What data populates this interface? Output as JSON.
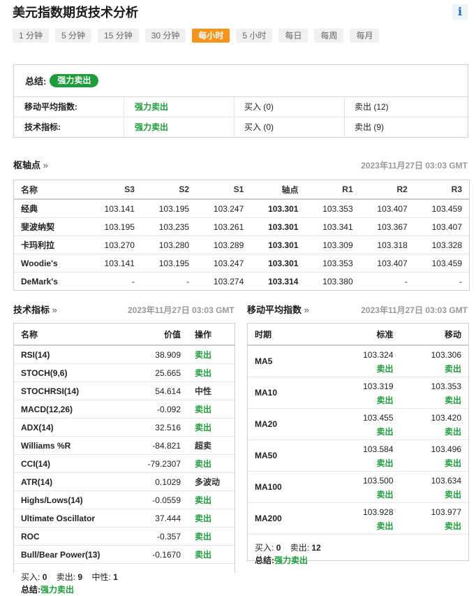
{
  "page_title": "美元指数期货技术分析",
  "info_icon": "i",
  "tabs": [
    "1 分钟",
    "5 分钟",
    "15 分钟",
    "30 分钟",
    "每小时",
    "5 小时",
    "每日",
    "每周",
    "每月"
  ],
  "active_tab": "每小时",
  "summary": {
    "label": "总结:",
    "verdict": "强力卖出",
    "rows": [
      {
        "name": "移动平均指数:",
        "verdict": "强力卖出",
        "buy": "买入 (0)",
        "sell": "卖出 (12)"
      },
      {
        "name": "技术指标:",
        "verdict": "强力卖出",
        "buy": "买入 (0)",
        "sell": "卖出 (9)"
      }
    ]
  },
  "pivot": {
    "title": "枢轴点",
    "arrow": "»",
    "time": "2023年11月27日 03:03 GMT",
    "headers": [
      "名称",
      "S3",
      "S2",
      "S1",
      "轴点",
      "R1",
      "R2",
      "R3"
    ],
    "rows": [
      [
        "经典",
        "103.141",
        "103.195",
        "103.247",
        "103.301",
        "103.353",
        "103.407",
        "103.459"
      ],
      [
        "斐波纳契",
        "103.195",
        "103.235",
        "103.261",
        "103.301",
        "103.341",
        "103.367",
        "103.407"
      ],
      [
        "卡玛利拉",
        "103.270",
        "103.280",
        "103.289",
        "103.301",
        "103.309",
        "103.318",
        "103.328"
      ],
      [
        "Woodie's",
        "103.141",
        "103.195",
        "103.247",
        "103.301",
        "103.353",
        "103.407",
        "103.459"
      ],
      [
        "DeMark's",
        "-",
        "-",
        "103.274",
        "103.314",
        "103.380",
        "-",
        "-"
      ]
    ]
  },
  "indicators": {
    "title": "技术指标",
    "arrow": "»",
    "time": "2023年11月27日 03:03 GMT",
    "headers": [
      "名称",
      "价值",
      "操作"
    ],
    "rows": [
      {
        "name": "RSI(14)",
        "value": "38.909",
        "action": "卖出",
        "tone": "green"
      },
      {
        "name": "STOCH(9,6)",
        "value": "25.665",
        "action": "卖出",
        "tone": "green"
      },
      {
        "name": "STOCHRSI(14)",
        "value": "54.614",
        "action": "中性",
        "tone": "dark"
      },
      {
        "name": "MACD(12,26)",
        "value": "-0.092",
        "action": "卖出",
        "tone": "green"
      },
      {
        "name": "ADX(14)",
        "value": "32.516",
        "action": "卖出",
        "tone": "green"
      },
      {
        "name": "Williams %R",
        "value": "-84.821",
        "action": "超卖",
        "tone": "dark"
      },
      {
        "name": "CCI(14)",
        "value": "-79.2307",
        "action": "卖出",
        "tone": "green"
      },
      {
        "name": "ATR(14)",
        "value": "0.1029",
        "action": "多波动",
        "tone": "dark"
      },
      {
        "name": "Highs/Lows(14)",
        "value": "-0.0559",
        "action": "卖出",
        "tone": "green"
      },
      {
        "name": "Ultimate Oscillator",
        "value": "37.444",
        "action": "卖出",
        "tone": "green"
      },
      {
        "name": "ROC",
        "value": "-0.357",
        "action": "卖出",
        "tone": "green"
      },
      {
        "name": "Bull/Bear Power(13)",
        "value": "-0.1670",
        "action": "卖出",
        "tone": "green"
      }
    ],
    "footer": {
      "buy_label": "买入:",
      "buy": "0",
      "sell_label": "卖出:",
      "sell": "9",
      "neutral_label": "中性:",
      "neutral": "1",
      "summary_label": "总结:",
      "summary": "强力卖出"
    }
  },
  "moving_averages": {
    "title": "移动平均指数",
    "arrow": "»",
    "time": "2023年11月27日 03:03 GMT",
    "headers": [
      "时期",
      "标准",
      "移动"
    ],
    "rows": [
      {
        "period": "MA5",
        "simple": "103.324",
        "simple_action": "卖出",
        "exp": "103.306",
        "exp_action": "卖出"
      },
      {
        "period": "MA10",
        "simple": "103.319",
        "simple_action": "卖出",
        "exp": "103.353",
        "exp_action": "卖出"
      },
      {
        "period": "MA20",
        "simple": "103.455",
        "simple_action": "卖出",
        "exp": "103.420",
        "exp_action": "卖出"
      },
      {
        "period": "MA50",
        "simple": "103.584",
        "simple_action": "卖出",
        "exp": "103.496",
        "exp_action": "卖出"
      },
      {
        "period": "MA100",
        "simple": "103.500",
        "simple_action": "卖出",
        "exp": "103.634",
        "exp_action": "卖出"
      },
      {
        "period": "MA200",
        "simple": "103.928",
        "simple_action": "卖出",
        "exp": "103.977",
        "exp_action": "卖出"
      }
    ],
    "footer": {
      "buy_label": "买入:",
      "buy": "0",
      "sell_label": "卖出:",
      "sell": "12",
      "summary_label": "总结:",
      "summary": "强力卖出"
    }
  },
  "colors": {
    "accent": "#f7941d",
    "sell_green": "#1e9c3c",
    "info_blue": "#2a6bb0"
  }
}
